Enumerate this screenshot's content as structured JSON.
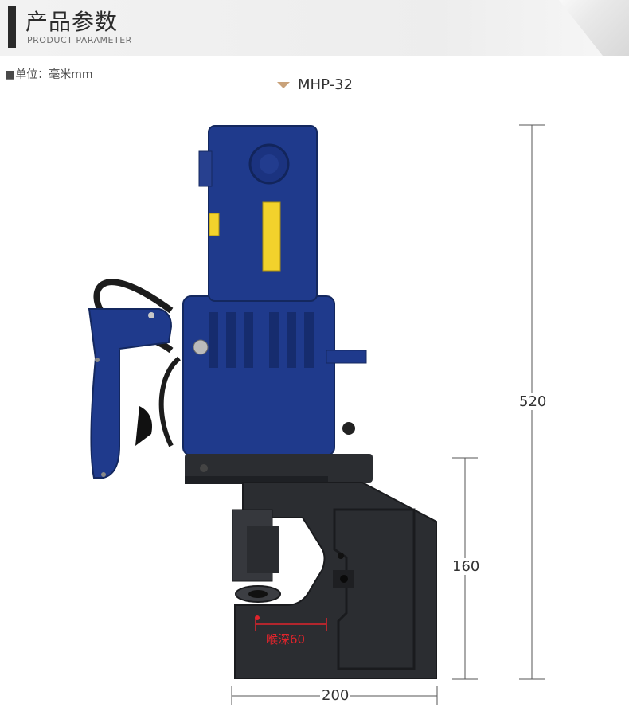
{
  "header": {
    "title": "产品参数",
    "subtitle": "PRODUCT PARAMETER"
  },
  "unit_note": "■单位：毫米mm",
  "model": {
    "name": "MHP-32"
  },
  "dimensions": {
    "height_total": "520",
    "height_frame": "160",
    "width_frame": "200",
    "throat_label": "喉深60"
  },
  "colors": {
    "motor_blue": "#1f3a8c",
    "frame_black": "#2b2d31",
    "warning_yellow": "#f2d22c",
    "throat_red": "#e0242c",
    "marker_tan": "#c9a27a"
  }
}
